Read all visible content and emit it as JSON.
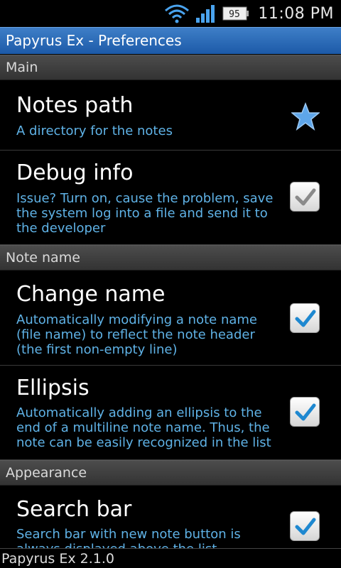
{
  "status_bar": {
    "time": "11:08 PM",
    "battery_level": "95",
    "icons": [
      "wifi-icon",
      "signal-icon",
      "battery-icon"
    ]
  },
  "app": {
    "title": "Papyrus Ex - Preferences"
  },
  "sections": [
    {
      "header": "Main"
    },
    {
      "header": "Note name"
    },
    {
      "header": "Appearance"
    }
  ],
  "prefs": {
    "notes_path": {
      "title": "Notes path",
      "summary": "A directory for the notes",
      "widget": "star-icon"
    },
    "debug_info": {
      "title": "Debug info",
      "summary": "Issue? Turn on, cause the problem, save the system log into a file and send it to the developer",
      "checked": true,
      "state": "checked-gray"
    },
    "change_name": {
      "title": "Change name",
      "summary": "Automatically modifying a note name (file name) to reflect the note header (the first non-empty line)",
      "checked": true
    },
    "ellipsis": {
      "title": "Ellipsis",
      "summary": "Automatically adding an ellipsis to the end of a multiline note name. Thus, the note can be easily recognized in the list",
      "checked": true
    },
    "search_bar": {
      "title": "Search bar",
      "summary": "Search bar with new note button is always displayed above the list",
      "checked": true
    }
  },
  "footer": {
    "version": "Papyrus Ex 2.1.0"
  },
  "colors": {
    "accent_blue": "#1c5aa8",
    "summary_text": "#5fb2e6",
    "check_blue": "#1e88d0",
    "check_gray": "#8a8a8a"
  }
}
